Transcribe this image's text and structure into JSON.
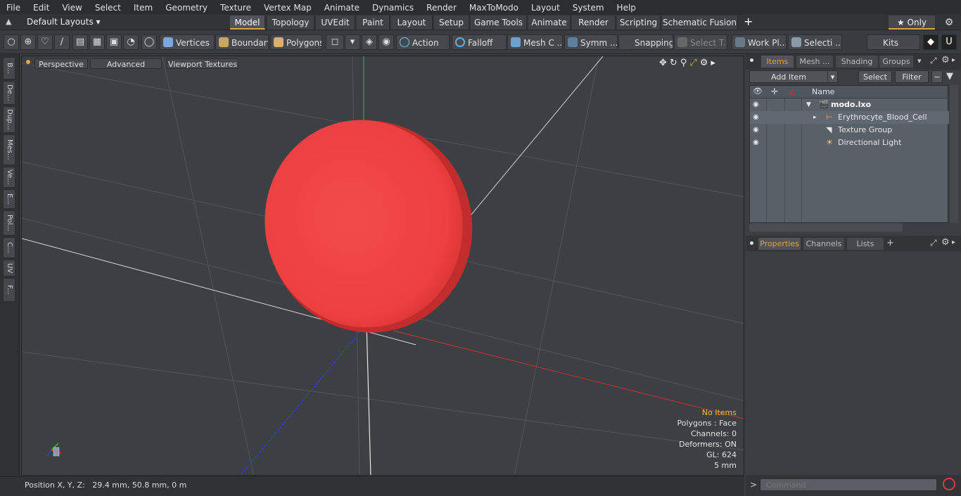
{
  "menu": [
    "File",
    "Edit",
    "View",
    "Select",
    "Item",
    "Geometry",
    "Texture",
    "Vertex Map",
    "Animate",
    "Dynamics",
    "Render",
    "MaxToModo",
    "Layout",
    "System",
    "Help"
  ],
  "layout_selector": "Default Layouts ▾",
  "layout_tabs": [
    "Model",
    "Topology",
    "UVEdit",
    "Paint",
    "Layout",
    "Setup",
    "Game Tools",
    "Animate",
    "Render",
    "Scripting",
    "Schematic Fusion"
  ],
  "layout_add": "+",
  "only_label": "★ Only",
  "toolbar": {
    "vertices": "Vertices",
    "boundary": "Boundary",
    "polygons": "Polygons",
    "action": "Action",
    "falloff": "Falloff",
    "mesh": "Mesh C ...",
    "symm": "Symm ...",
    "snapping": "Snapping",
    "select_t": "Select T...",
    "work_pl": "Work Pl...",
    "selecti": "Selecti ...",
    "kits": "Kits"
  },
  "left_tabs": [
    "B...",
    "De...",
    "Dup...",
    "Mes...",
    "Ve...",
    "E...",
    "Pol...",
    "C...",
    "UV",
    "F..."
  ],
  "viewport": {
    "tabs": [
      "Perspective",
      "Advanced",
      "Viewport Textures"
    ],
    "stats": {
      "no_items": "No Items",
      "polygons": "Polygons : Face",
      "channels": "Channels: 0",
      "deformers": "Deformers: ON",
      "gl": "GL: 624",
      "unit": "5 mm"
    },
    "object_color": "#f04848"
  },
  "status": "Position X, Y, Z:   29.4 mm, 50.8 mm, 0 m",
  "items_panel": {
    "tabs": [
      "Items",
      "Mesh ...",
      "Shading",
      "Groups"
    ],
    "add_item": "Add Item",
    "select": "Select",
    "filter": "Filter",
    "column_name": "Name",
    "tree": [
      {
        "label": "modo.lxo",
        "bold": true
      },
      {
        "label": "Erythrocyte_Blood_Cell"
      },
      {
        "label": "Texture Group"
      },
      {
        "label": "Directional Light"
      }
    ]
  },
  "properties_panel": {
    "tabs": [
      "Properties",
      "Channels",
      "Lists"
    ],
    "add": "+"
  },
  "command": {
    "placeholder": "Command",
    "prompt": ">"
  },
  "colors": {
    "accent": "#e8a33c",
    "x_axis": "#d03030",
    "y_axis": "#30c030",
    "z_axis": "#3040d0"
  }
}
